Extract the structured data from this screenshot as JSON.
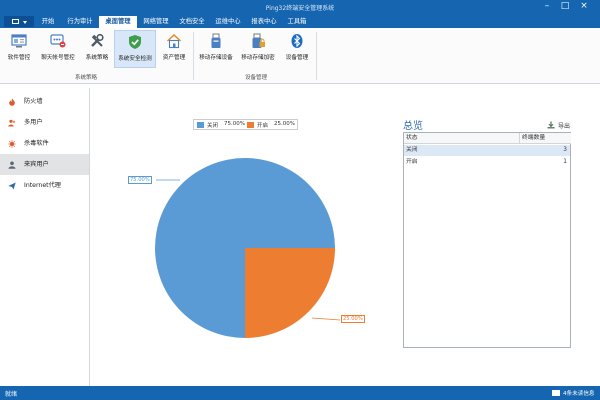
{
  "window": {
    "title": "Ping32终端安全管理系统"
  },
  "menu": {
    "tabs": [
      {
        "label": "开始"
      },
      {
        "label": "行为审计"
      },
      {
        "label": "桌面管理"
      },
      {
        "label": "网络管理"
      },
      {
        "label": "文档安全"
      },
      {
        "label": "运维中心"
      },
      {
        "label": "报表中心"
      },
      {
        "label": "工具箱"
      }
    ],
    "active_tab": "桌面管理"
  },
  "ribbon": {
    "buttons": [
      {
        "label": "软件管控",
        "icon": "software-control-icon"
      },
      {
        "label": "聊天帐号管控",
        "icon": "chat-account-icon"
      },
      {
        "label": "系统策略",
        "icon": "tools-icon"
      },
      {
        "label": "系统安全检测",
        "icon": "shield-check-icon"
      },
      {
        "label": "资产管理",
        "icon": "asset-house-icon"
      },
      {
        "label": "移动存储设备",
        "icon": "usb-storage-icon"
      },
      {
        "label": "移动存储加密",
        "icon": "usb-lock-icon"
      },
      {
        "label": "设备管理",
        "icon": "bluetooth-icon"
      }
    ],
    "groups": [
      {
        "label": "系统策略"
      },
      {
        "label": "设备管理"
      }
    ]
  },
  "sidebar": {
    "items": [
      {
        "label": "防火墙",
        "icon": "fire-icon"
      },
      {
        "label": "多用户",
        "icon": "users-icon"
      },
      {
        "label": "杀毒软件",
        "icon": "antivirus-icon"
      },
      {
        "label": "来宾用户",
        "icon": "guest-user-icon"
      },
      {
        "label": "Internet代理",
        "icon": "proxy-plane-icon"
      }
    ],
    "active_item": "来宾用户"
  },
  "chart_data": {
    "type": "pie",
    "slices": [
      {
        "label": "关闭",
        "value": 75.0,
        "display": "75.00%",
        "color": "#5b9bd5"
      },
      {
        "label": "开启",
        "value": 25.0,
        "display": "25.00%",
        "color": "#ed7d31"
      }
    ],
    "legend": [
      {
        "label": "关闭",
        "value": "75.00%"
      },
      {
        "label": "开启",
        "value": "25.00%"
      }
    ],
    "legend_position": "top"
  },
  "overview": {
    "title": "总览",
    "export_label": "导出",
    "columns": [
      "状态",
      "终端数量"
    ],
    "rows": [
      {
        "status": "关闭",
        "count": "3"
      },
      {
        "status": "开启",
        "count": "1"
      }
    ]
  },
  "statusbar": {
    "left": "就绪",
    "right": "4条未读信息"
  },
  "colors": {
    "accent": "#1565b0",
    "closed": "#5b9bd5",
    "open": "#ed7d31"
  }
}
